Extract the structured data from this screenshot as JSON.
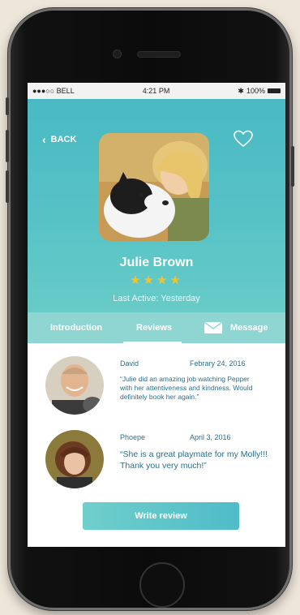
{
  "status_bar": {
    "carrier": "●●●○○ BELL",
    "time": "4:21 PM",
    "battery": "100%"
  },
  "header": {
    "back_label": "BACK"
  },
  "profile": {
    "name": "Julie Brown",
    "stars": "★★★★",
    "rating": 4,
    "last_active": "Last Active: Yesterday"
  },
  "tabs": {
    "introduction": "Introduction",
    "reviews": "Reviews",
    "message": "Message",
    "active": "Reviews"
  },
  "reviews": [
    {
      "name": "David",
      "date": "Febrary 24, 2016",
      "text": "“Julie did an amazing job watching Pepper with her attentiveness and kindness. Would definitely book her again.”"
    },
    {
      "name": "Phoepe",
      "date": "April 3, 2016",
      "text": "“She is a great playmate for my Molly!!! Thank you very much!”"
    }
  ],
  "actions": {
    "write_review": "Write review"
  },
  "colors": {
    "teal": "#4ab9c3",
    "tab_bar": "#8fd6d3",
    "star": "#f6c12b",
    "review_text": "#2b6f88"
  }
}
